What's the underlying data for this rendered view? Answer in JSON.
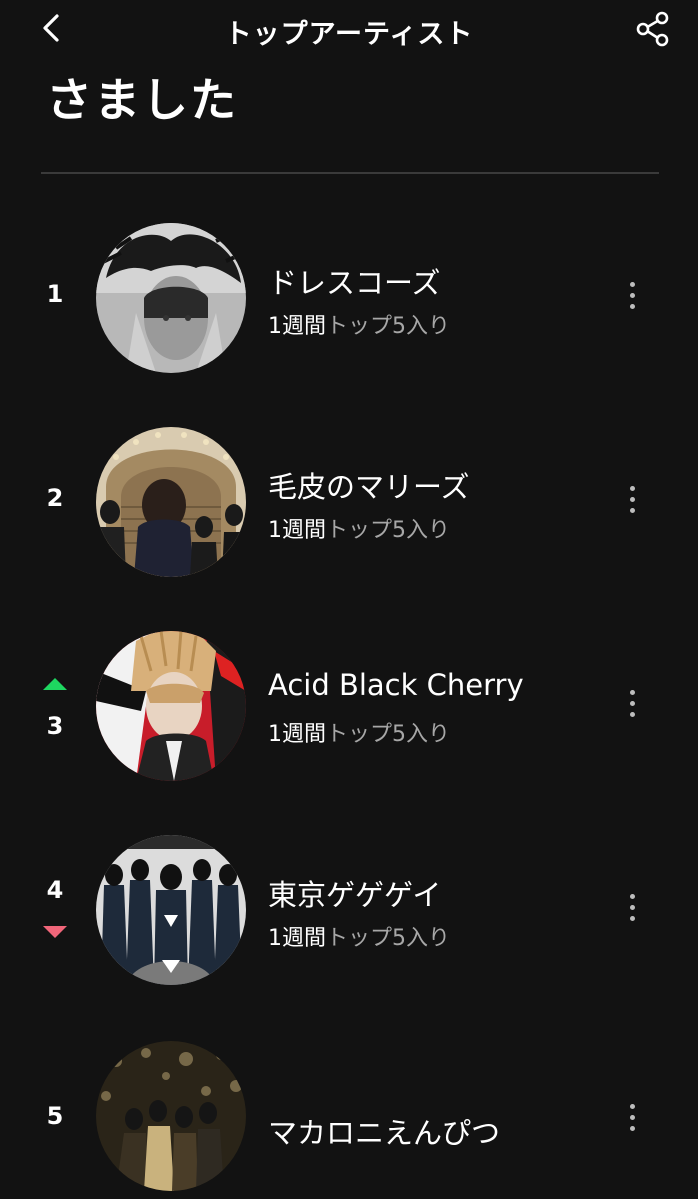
{
  "header": {
    "title": "トップアーティスト",
    "back_icon": "chevron-left-icon",
    "share_icon": "share-icon"
  },
  "heading": "さました",
  "colors": {
    "background": "#121212",
    "text": "#ffffff",
    "secondary_text": "#a7a7a7",
    "trend_up": "#1ed760",
    "trend_down": "#f1667a",
    "divider": "#3a3a3a"
  },
  "artists": [
    {
      "rank": "1",
      "name": "ドレスコーズ",
      "weeks": "1週間",
      "suffix": "トップ5入り",
      "trend": "none"
    },
    {
      "rank": "2",
      "name": "毛皮のマリーズ",
      "weeks": "1週間",
      "suffix": "トップ5入り",
      "trend": "none"
    },
    {
      "rank": "3",
      "name": "Acid Black Cherry",
      "weeks": "1週間",
      "suffix": "トップ5入り",
      "trend": "up"
    },
    {
      "rank": "4",
      "name": "東京ゲゲゲイ",
      "weeks": "1週間",
      "suffix": "トップ5入り",
      "trend": "down"
    },
    {
      "rank": "5",
      "name": "マカロニえんぴつ",
      "weeks": "",
      "suffix": "",
      "trend": "none"
    }
  ]
}
